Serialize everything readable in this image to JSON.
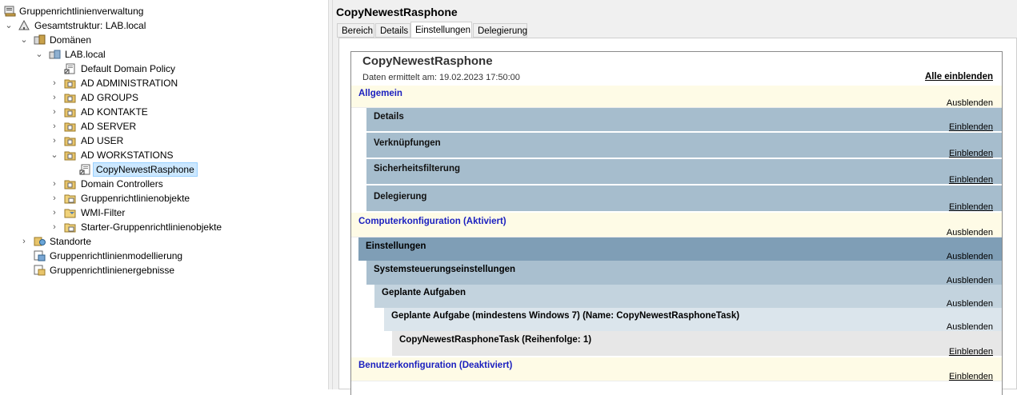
{
  "tree": {
    "items": [
      {
        "label": "Gruppenrichtlinienverwaltung",
        "icon": "gpmc-console-icon",
        "chevron": ""
      },
      {
        "label": "Gesamtstruktur: LAB.local",
        "icon": "forest-icon",
        "chevron": "v"
      },
      {
        "label": "Domänen",
        "icon": "domains-icon",
        "chevron": "v"
      },
      {
        "label": "LAB.local",
        "icon": "domain-icon",
        "chevron": "v"
      },
      {
        "label": "Default Domain Policy",
        "icon": "gpo-link-icon",
        "chevron": ""
      },
      {
        "label": "AD ADMINISTRATION",
        "icon": "ou-folder-icon",
        "chevron": ">"
      },
      {
        "label": "AD GROUPS",
        "icon": "ou-folder-icon",
        "chevron": ">"
      },
      {
        "label": "AD KONTAKTE",
        "icon": "ou-folder-icon",
        "chevron": ">"
      },
      {
        "label": "AD SERVER",
        "icon": "ou-folder-icon",
        "chevron": ">"
      },
      {
        "label": "AD USER",
        "icon": "ou-folder-icon",
        "chevron": ">"
      },
      {
        "label": "AD WORKSTATIONS",
        "icon": "ou-folder-icon",
        "chevron": "v"
      },
      {
        "label": "CopyNewestRasphone",
        "icon": "gpo-link-icon",
        "chevron": ""
      },
      {
        "label": "Domain Controllers",
        "icon": "ou-folder-icon",
        "chevron": ">"
      },
      {
        "label": "Gruppenrichtlinienobjekte",
        "icon": "folder-icon",
        "chevron": ">"
      },
      {
        "label": "WMI-Filter",
        "icon": "folder-icon",
        "chevron": ">"
      },
      {
        "label": "Starter-Gruppenrichtlinienobjekte",
        "icon": "folder-icon",
        "chevron": ">"
      },
      {
        "label": "Standorte",
        "icon": "sites-icon",
        "chevron": ">"
      },
      {
        "label": "Gruppenrichtlinienmodellierung",
        "icon": "modeling-icon",
        "chevron": ""
      },
      {
        "label": "Gruppenrichtlinienergebnisse",
        "icon": "results-icon",
        "chevron": ""
      }
    ]
  },
  "right": {
    "title": "CopyNewestRasphone",
    "tabs": [
      "Bereich",
      "Details",
      "Einstellungen",
      "Delegierung"
    ],
    "active_tab": "Einstellungen"
  },
  "report": {
    "title": "CopyNewestRasphone",
    "date": "Daten ermittelt am: 19.02.2023 17:50:00",
    "show_all": "Alle einblenden",
    "sections": [
      {
        "label": "Allgemein",
        "action": "Ausblenden"
      },
      {
        "label": "Details",
        "action": "Einblenden"
      },
      {
        "label": "Verknüpfungen",
        "action": "Einblenden"
      },
      {
        "label": "Sicherheitsfilterung",
        "action": "Einblenden"
      },
      {
        "label": "Delegierung",
        "action": "Einblenden"
      },
      {
        "label": "Computerkonfiguration (Aktiviert)",
        "action": "Ausblenden"
      },
      {
        "label": "Einstellungen",
        "action": "Ausblenden"
      },
      {
        "label": "Systemsteuerungseinstellungen",
        "action": "Ausblenden"
      },
      {
        "label": "Geplante Aufgaben",
        "action": "Ausblenden"
      },
      {
        "label": "Geplante Aufgabe (mindestens Windows 7) (Name: CopyNewestRasphoneTask)",
        "action": "Ausblenden"
      },
      {
        "label": "CopyNewestRasphoneTask (Reihenfolge: 1)",
        "action": "Einblenden"
      },
      {
        "label": "Benutzerkonfiguration (Deaktiviert)",
        "action": "Einblenden"
      }
    ]
  },
  "colors": {
    "selection": "#cce8ff",
    "category_bg": "#fefbe6",
    "category_text": "#1a1fbf",
    "subsection_bg": "#a6bdcd"
  }
}
